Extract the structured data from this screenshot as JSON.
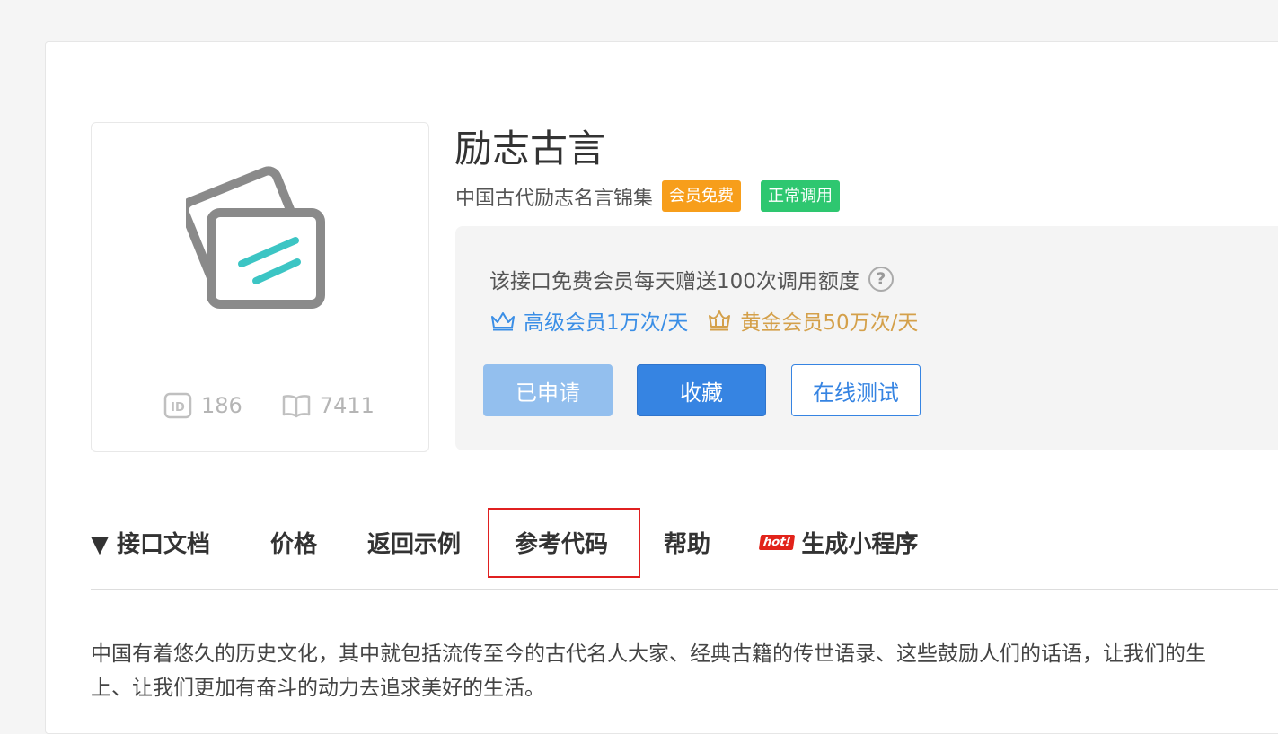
{
  "api": {
    "title": "励志古言",
    "subtitle": "中国古代励志名言锦集",
    "badges": {
      "member_free": "会员免费",
      "status": "正常调用"
    },
    "id_value": "186",
    "views_value": "7411"
  },
  "quota": {
    "text": "该接口免费会员每天赠送100次调用额度",
    "help": "?",
    "senior": "高级会员1万次/天",
    "gold": "黄金会员50万次/天"
  },
  "buttons": {
    "applied": "已申请",
    "favorite": "收藏",
    "online_test": "在线测试"
  },
  "tabs": {
    "doc": "▼ 接口文档",
    "price": "价格",
    "example": "返回示例",
    "code": "参考代码",
    "help": "帮助",
    "hot_tag": "hot!",
    "mini_program": "生成小程序"
  },
  "description": {
    "line1": "中国有着悠久的历史文化，其中就包括流传至今的古代名人大家、经典古籍的传世语录、这些鼓励人们的话语，让我们的生",
    "line2": "上、让我们更加有奋斗的动力去追求美好的生活。"
  },
  "colors": {
    "accent_blue": "#3684e2",
    "badge_orange": "#f79e1b",
    "badge_green": "#2ec770",
    "gold": "#d4a04a",
    "active_tab_border": "#e02020"
  }
}
